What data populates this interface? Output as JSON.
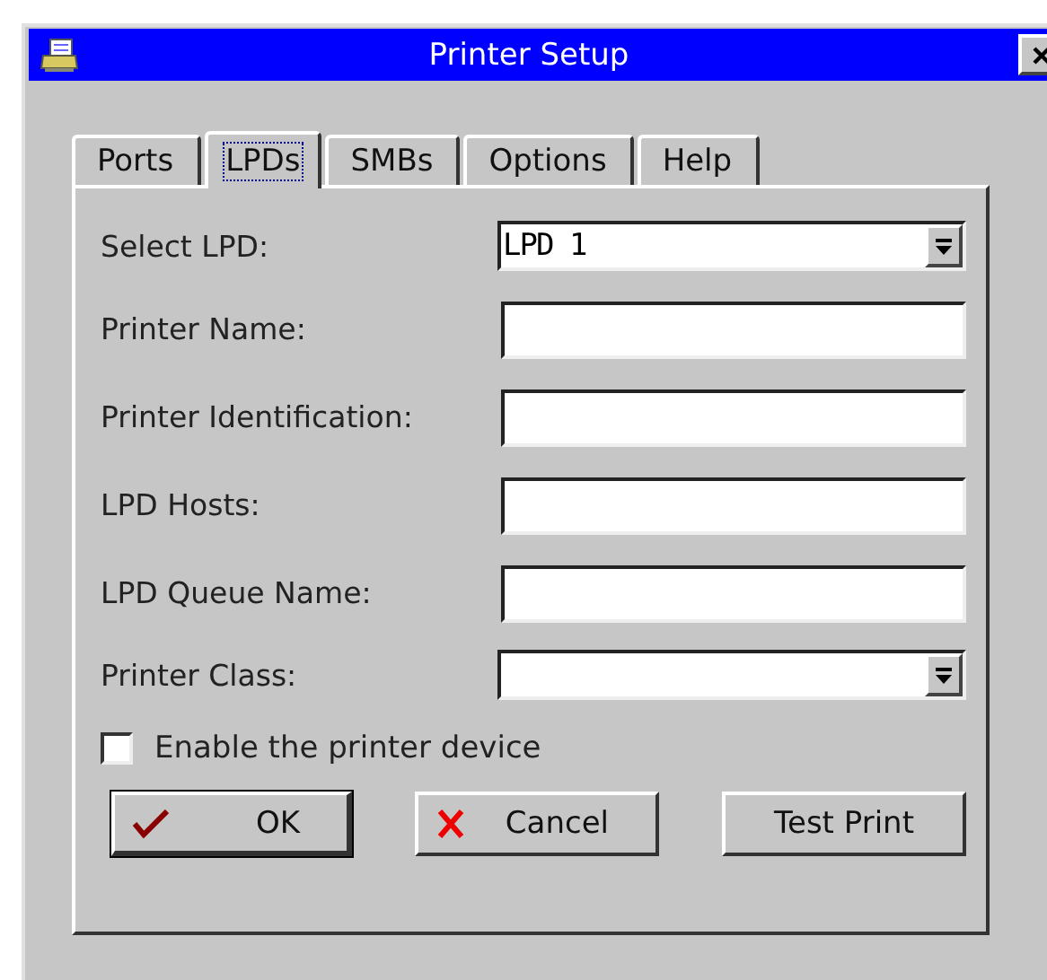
{
  "window": {
    "title": "Printer Setup"
  },
  "tabs": [
    {
      "label": "Ports",
      "selected": false
    },
    {
      "label": "LPDs",
      "selected": true
    },
    {
      "label": "SMBs",
      "selected": false
    },
    {
      "label": "Options",
      "selected": false
    },
    {
      "label": "Help",
      "selected": false
    }
  ],
  "fields": [
    {
      "kind": "dropdown",
      "label": "Select LPD:",
      "value": "LPD 1"
    },
    {
      "kind": "text",
      "label": "Printer Name:"
    },
    {
      "kind": "text",
      "label": "Printer Identification:"
    },
    {
      "kind": "text",
      "label": "LPD Hosts:"
    },
    {
      "kind": "text",
      "label": "LPD Queue Name:"
    },
    {
      "kind": "dropdown",
      "label": "Printer Class:"
    }
  ],
  "enable_checkbox": {
    "label": "Enable the printer device",
    "checked": false
  },
  "buttons": [
    {
      "kind": "ok",
      "label": "OK",
      "default": true
    },
    {
      "kind": "cancel",
      "label": "Cancel",
      "default": false
    },
    {
      "kind": "plain",
      "label": "Test Print",
      "default": false
    }
  ]
}
